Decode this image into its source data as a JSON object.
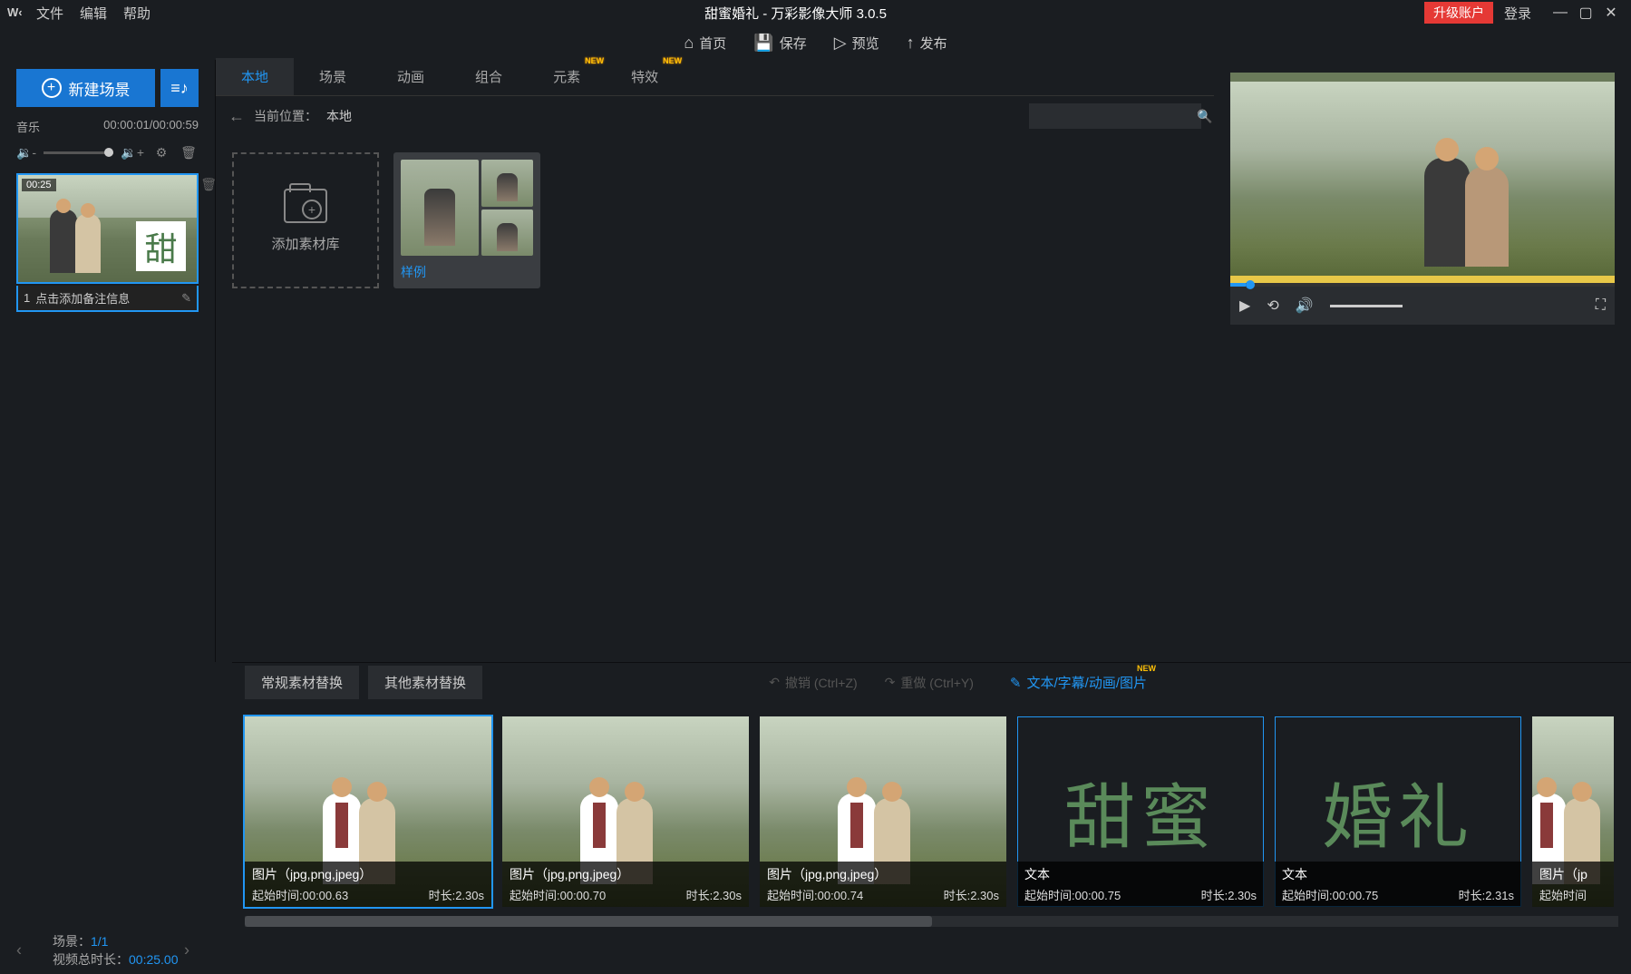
{
  "titlebar": {
    "logo": "W‹",
    "menus": {
      "file": "文件",
      "edit": "编辑",
      "help": "帮助"
    },
    "title": "甜蜜婚礼 - 万彩影像大师 3.0.5",
    "upgrade": "升级账户",
    "login": "登录"
  },
  "toolbar": {
    "home": "首页",
    "save": "保存",
    "preview": "预览",
    "publish": "发布"
  },
  "leftpanel": {
    "new_scene": "新建场景",
    "music_label": "音乐",
    "music_time": "00:00:01/00:00:59",
    "scene": {
      "duration": "00:25",
      "char": "甜",
      "index": "1",
      "caption": "点击添加备注信息"
    }
  },
  "tabs": {
    "local": "本地",
    "scene": "场景",
    "animation": "动画",
    "combo": "组合",
    "element": "元素",
    "effect": "特效",
    "new": "NEW"
  },
  "breadcrumb": {
    "label": "当前位置：",
    "value": "本地"
  },
  "assets": {
    "add_lib": "添加素材库",
    "sample": "样例"
  },
  "bottom": {
    "tab_normal": "常规素材替换",
    "tab_other": "其他素材替换",
    "undo": "撤销 (Ctrl+Z)",
    "redo": "重做 (Ctrl+Y)",
    "text_link": "文本/字幕/动画/图片",
    "new": "NEW"
  },
  "clips": [
    {
      "type": "image",
      "title": "图片（jpg,png,jpeg）",
      "start_lbl": "起始时间:",
      "start": "00:00.63",
      "dur_lbl": "时长:",
      "dur": "2.30s",
      "selected": true
    },
    {
      "type": "image",
      "title": "图片（jpg,png,jpeg）",
      "start_lbl": "起始时间:",
      "start": "00:00.70",
      "dur_lbl": "时长:",
      "dur": "2.30s",
      "selected": false
    },
    {
      "type": "image",
      "title": "图片（jpg,png,jpeg）",
      "start_lbl": "起始时间:",
      "start": "00:00.74",
      "dur_lbl": "时长:",
      "dur": "2.30s",
      "selected": false
    },
    {
      "type": "text",
      "title": "文本",
      "char": "甜蜜",
      "start_lbl": "起始时间:",
      "start": "00:00.75",
      "dur_lbl": "时长:",
      "dur": "2.30s",
      "selected": false
    },
    {
      "type": "text",
      "title": "文本",
      "char": "婚礼",
      "start_lbl": "起始时间:",
      "start": "00:00.75",
      "dur_lbl": "时长:",
      "dur": "2.31s",
      "selected": false
    },
    {
      "type": "image",
      "title": "图片（jp",
      "start_lbl": "起始时间",
      "start": "",
      "dur_lbl": "",
      "dur": "",
      "selected": false
    }
  ],
  "status": {
    "scene_lbl": "场景：",
    "scene_val": "1/1",
    "total_lbl": "视频总时长：",
    "total_val": "00:25.00"
  }
}
